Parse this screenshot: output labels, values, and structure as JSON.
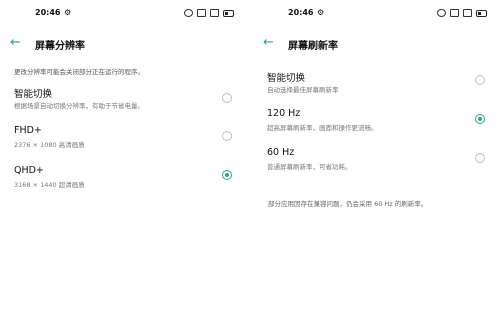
{
  "left": {
    "status": {
      "time": "20:46"
    },
    "title": "屏幕分辨率",
    "description": "更改分辨率可能会关闭部分正在运行的程序。",
    "options": [
      {
        "title": "智能切换",
        "subtitle": "根据场景自动切换分辨率，有助于节省电量。",
        "checked": false
      },
      {
        "title": "FHD+",
        "subtitle": "2376 × 1080 高清画质",
        "checked": false
      },
      {
        "title": "QHD+",
        "subtitle": "3168 × 1440 超清画质",
        "checked": true
      }
    ]
  },
  "right": {
    "status": {
      "time": "20:46"
    },
    "title": "屏幕刷新率",
    "options": [
      {
        "title": "智能切换",
        "subtitle": "自动选择最佳屏幕刷新率",
        "checked": false
      },
      {
        "title": "120 Hz",
        "subtitle": "超高屏幕刷新率，画面和操作更流畅。",
        "checked": true
      },
      {
        "title": "60 Hz",
        "subtitle": "普通屏幕刷新率，可省功耗。",
        "checked": false
      }
    ],
    "footer": "部分应用因存在兼容问题，仍会采用 60 Hz 的刷新率。"
  },
  "accent_color": "#2aa876"
}
